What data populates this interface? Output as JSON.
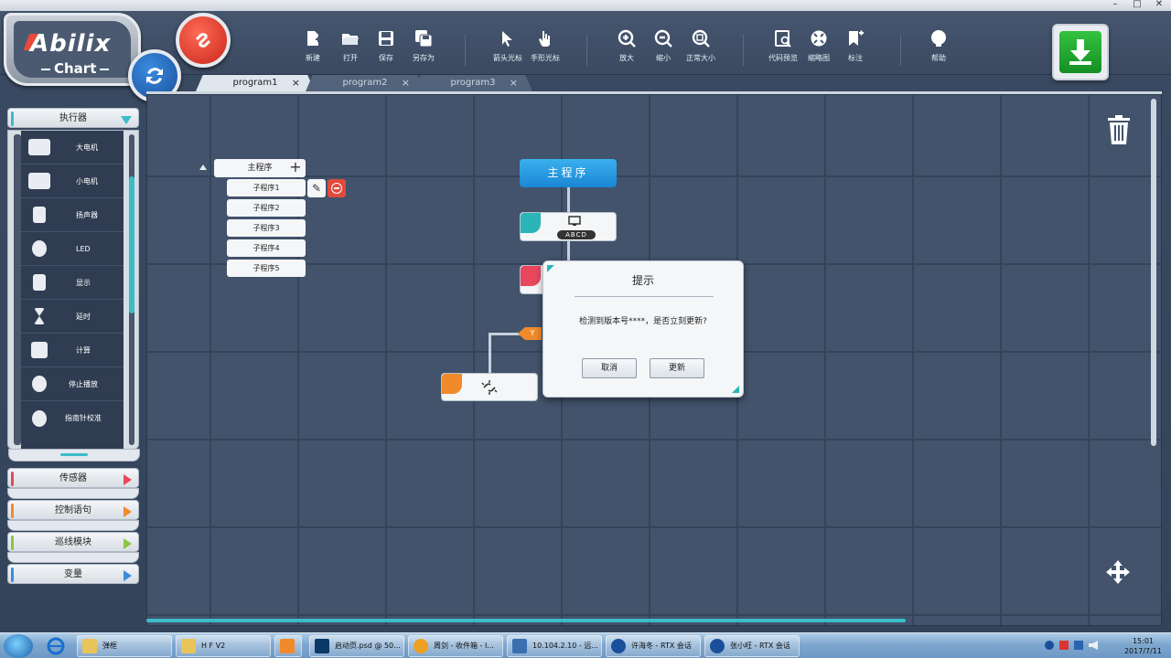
{
  "window": {
    "controls": [
      "–",
      "□",
      "✕"
    ]
  },
  "logo": {
    "title": "Abilix",
    "subtitle": "Chart"
  },
  "toolbar": {
    "tools": [
      {
        "label": "新建",
        "icon": "new-file-icon"
      },
      {
        "label": "打开",
        "icon": "folder-open-icon"
      },
      {
        "label": "保存",
        "icon": "save-icon"
      },
      {
        "label": "另存为",
        "icon": "save-as-icon"
      },
      {
        "label": "箭头光标",
        "icon": "arrow-cursor-icon"
      },
      {
        "label": "手形光标",
        "icon": "hand-cursor-icon"
      },
      {
        "label": "放大",
        "icon": "zoom-in-icon"
      },
      {
        "label": "缩小",
        "icon": "zoom-out-icon"
      },
      {
        "label": "正常大小",
        "icon": "actual-size-icon"
      },
      {
        "label": "代码预览",
        "icon": "code-preview-icon"
      },
      {
        "label": "缩略图",
        "icon": "thumbnail-icon"
      },
      {
        "label": "标注",
        "icon": "bookmark-icon"
      },
      {
        "label": "帮助",
        "icon": "help-icon"
      }
    ]
  },
  "tabs": [
    {
      "label": "program1",
      "active": true
    },
    {
      "label": "program2",
      "active": false
    },
    {
      "label": "program3",
      "active": false
    }
  ],
  "tab_close": "×",
  "sidebar": {
    "categories": [
      {
        "label": "执行器",
        "color": "#3bbcc8",
        "expanded": true
      },
      {
        "label": "传感器",
        "color": "#e8475e"
      },
      {
        "label": "控制语句",
        "color": "#f08a2a"
      },
      {
        "label": "巡线模块",
        "color": "#8cc63f"
      },
      {
        "label": "变量",
        "color": "#3b8ce0"
      }
    ],
    "actuator_items": [
      {
        "label": "大电机",
        "icon": "large-motor-icon"
      },
      {
        "label": "小电机",
        "icon": "small-motor-icon"
      },
      {
        "label": "扬声器",
        "icon": "speaker-icon"
      },
      {
        "label": "LED",
        "icon": "led-icon"
      },
      {
        "label": "显示",
        "icon": "display-icon"
      },
      {
        "label": "延时",
        "icon": "hourglass-icon"
      },
      {
        "label": "计算",
        "icon": "calculator-icon"
      },
      {
        "label": "停止播放",
        "icon": "stop-icon"
      },
      {
        "label": "指南针校准",
        "icon": "compass-icon"
      }
    ]
  },
  "program_tree": {
    "root": "主程序",
    "plus": "+",
    "edit": "✎",
    "subs": [
      "子程序1",
      "子程序2",
      "子程序3",
      "子程序4",
      "子程序5"
    ]
  },
  "flow": {
    "main_label": "主程序",
    "display_text": "ABCD",
    "branch_label": "Y"
  },
  "dialog": {
    "title": "提示",
    "message": "检测到版本号****，是否立刻更新?",
    "cancel": "取消",
    "update": "更新"
  },
  "taskbar": {
    "items": [
      {
        "label": "弹框",
        "color": "#e8c45a"
      },
      {
        "label": "H F  V2",
        "color": "#e8c45a"
      },
      {
        "label": "",
        "color": "#f08a2a"
      },
      {
        "label": "启动页.psd @ 50...",
        "color": "#0b3a66"
      },
      {
        "label": "周剑 - 收件箱 - I...",
        "color": "#f0a020"
      },
      {
        "label": "10.104.2.10 - 远...",
        "color": "#3a6fb0"
      },
      {
        "label": "许海冬 - RTX 会话",
        "color": "#1a4f9c"
      },
      {
        "label": "张小旺 - RTX 会话",
        "color": "#1a4f9c"
      }
    ],
    "time": "15:01",
    "date": "2017/7/11"
  }
}
